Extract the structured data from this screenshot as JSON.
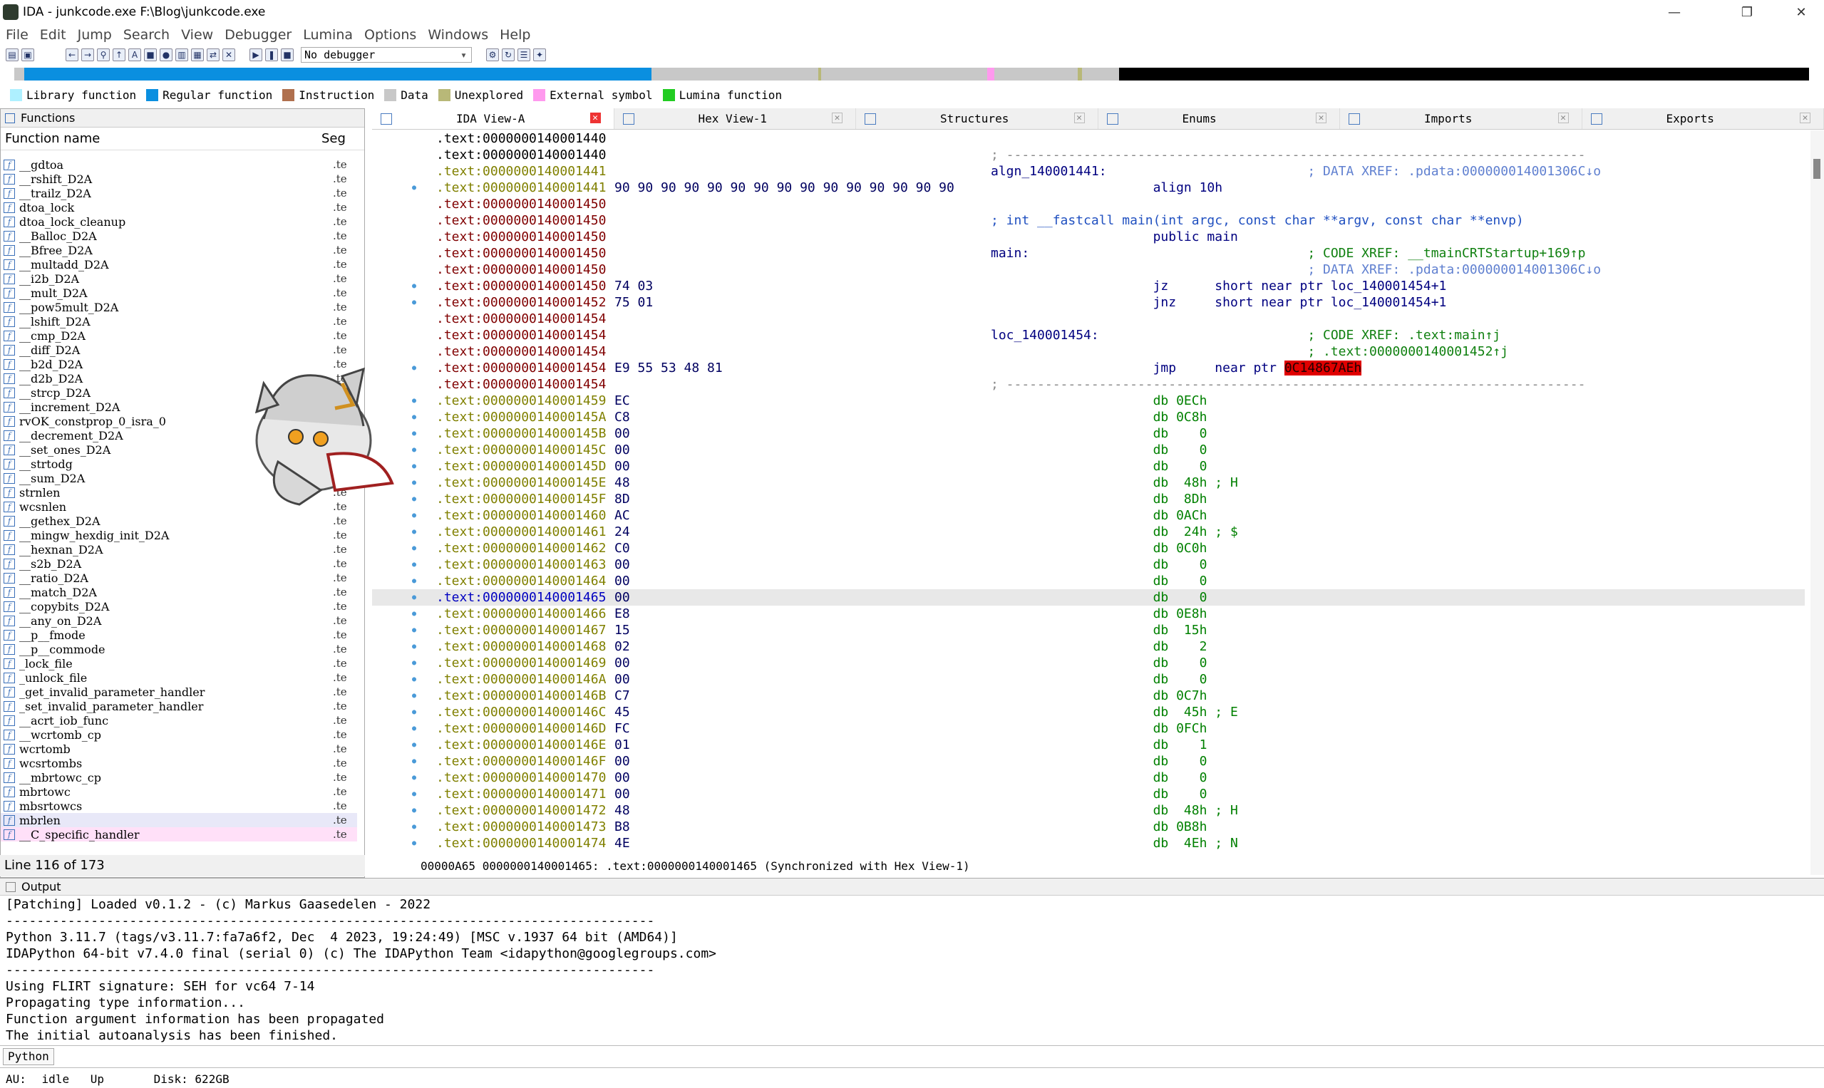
{
  "window": {
    "title": "IDA - junkcode.exe F:\\Blog\\junkcode.exe",
    "min_icon": "minimize-icon",
    "max_icon": "maximize-icon",
    "close_icon": "close-icon"
  },
  "menu": [
    "File",
    "Edit",
    "Jump",
    "Search",
    "View",
    "Debugger",
    "Lumina",
    "Options",
    "Windows",
    "Help"
  ],
  "toolbar": {
    "debugger_select": "No debugger"
  },
  "legend": [
    {
      "label": "Library function",
      "color": "#aef0ff"
    },
    {
      "label": "Regular function",
      "color": "#0a8fe0"
    },
    {
      "label": "Instruction",
      "color": "#b0704e"
    },
    {
      "label": "Data",
      "color": "#c8c8c8"
    },
    {
      "label": "Unexplored",
      "color": "#b8b878"
    },
    {
      "label": "External symbol",
      "color": "#ff99ee"
    },
    {
      "label": "Lumina function",
      "color": "#22cc22"
    }
  ],
  "functions": {
    "title": "Functions",
    "col_name": "Function name",
    "col_seg": "Seg",
    "items": [
      "__gdtoa",
      "__rshift_D2A",
      "__trailz_D2A",
      "dtoa_lock",
      "dtoa_lock_cleanup",
      "__Balloc_D2A",
      "__Bfree_D2A",
      "__multadd_D2A",
      "__i2b_D2A",
      "__mult_D2A",
      "__pow5mult_D2A",
      "__lshift_D2A",
      "__cmp_D2A",
      "__diff_D2A",
      "__b2d_D2A",
      "__d2b_D2A",
      "__strcp_D2A",
      "__increment_D2A",
      "rvOK_constprop_0_isra_0",
      "__decrement_D2A",
      "__set_ones_D2A",
      "__strtodg",
      "__sum_D2A",
      "strnlen",
      "wcsnlen",
      "__gethex_D2A",
      "__mingw_hexdig_init_D2A",
      "__hexnan_D2A",
      "__s2b_D2A",
      "__ratio_D2A",
      "__match_D2A",
      "__copybits_D2A",
      "__any_on_D2A",
      "__p__fmode",
      "__p__commode",
      "_lock_file",
      "_unlock_file",
      "_get_invalid_parameter_handler",
      "_set_invalid_parameter_handler",
      "__acrt_iob_func",
      "__wcrtomb_cp",
      "wcrtomb",
      "wcsrtombs",
      "__mbrtowc_cp",
      "mbrtowc",
      "mbsrtowcs",
      "mbrlen",
      "__C_specific_handler"
    ],
    "seg": ".te",
    "status": "Line 116 of 173"
  },
  "tabs": [
    {
      "label": "IDA View-A",
      "icon": "ida-view-icon"
    },
    {
      "label": "Hex View-1",
      "icon": "hex-view-icon"
    },
    {
      "label": "Structures",
      "icon": "structures-icon"
    },
    {
      "label": "Enums",
      "icon": "enums-icon"
    },
    {
      "label": "Imports",
      "icon": "imports-icon"
    },
    {
      "label": "Exports",
      "icon": "exports-icon"
    }
  ],
  "disasm": [
    {
      "addr": ".text:0000000140001440",
      "ac": "k",
      "bytes": "",
      "r": []
    },
    {
      "addr": ".text:0000000140001440",
      "ac": "k",
      "bytes": "",
      "r": [
        {
          "t": "; ---------------------------------------------------------------------------",
          "c": "grey"
        }
      ]
    },
    {
      "addr": ".text:0000000140001441",
      "ac": "g",
      "bytes": "",
      "r": [
        {
          "t": "algn_140001441:",
          "c": "navy"
        },
        {
          "t": "                          ; DATA XREF: .pdata:000000014001306C↓o",
          "c": "lblue"
        }
      ]
    },
    {
      "addr": ".text:0000000140001441",
      "ac": "g",
      "dot": true,
      "bytes": "90 90 90 90 90 90 90 90 90 90 90 90 90 90 90",
      "r": [
        {
          "t": "                     align 10h",
          "c": "navy"
        }
      ]
    },
    {
      "addr": ".text:0000000140001450",
      "ac": "r",
      "bytes": "",
      "r": []
    },
    {
      "addr": ".text:0000000140001450",
      "ac": "r",
      "bytes": "",
      "r": [
        {
          "t": "; int __fastcall main(int argc, const char **argv, const char **envp)",
          "c": "blue"
        }
      ]
    },
    {
      "addr": ".text:0000000140001450",
      "ac": "r",
      "bytes": "",
      "r": [
        {
          "t": "                     public main",
          "c": "navy"
        }
      ]
    },
    {
      "addr": ".text:0000000140001450",
      "ac": "r",
      "bytes": "",
      "r": [
        {
          "t": "main:",
          "c": "navy"
        },
        {
          "t": "                                    ; CODE XREF: __tmainCRTStartup+169↑p",
          "c": "green"
        }
      ]
    },
    {
      "addr": ".text:0000000140001450",
      "ac": "r",
      "bytes": "",
      "r": [
        {
          "t": "                                         ; DATA XREF: .pdata:000000014001306C↓o",
          "c": "lblue"
        }
      ]
    },
    {
      "addr": ".text:0000000140001450",
      "ac": "r",
      "dot": true,
      "bytes": "74 03",
      "r": [
        {
          "t": "                     jz      short near ptr loc_140001454+1",
          "c": "navy"
        }
      ]
    },
    {
      "addr": ".text:0000000140001452",
      "ac": "r",
      "dot": true,
      "bytes": "75 01",
      "r": [
        {
          "t": "                     jnz     short near ptr loc_140001454+1",
          "c": "navy"
        }
      ]
    },
    {
      "addr": ".text:0000000140001454",
      "ac": "r",
      "bytes": "",
      "r": []
    },
    {
      "addr": ".text:0000000140001454",
      "ac": "r",
      "bytes": "",
      "r": [
        {
          "t": "loc_140001454:",
          "c": "navy"
        },
        {
          "t": "                           ; CODE XREF: .text:main↑j",
          "c": "green"
        }
      ]
    },
    {
      "addr": ".text:0000000140001454",
      "ac": "r",
      "bytes": "",
      "r": [
        {
          "t": "                                         ; .text:0000000140001452↑j",
          "c": "green"
        }
      ]
    },
    {
      "addr": ".text:0000000140001454",
      "ac": "r",
      "dot": true,
      "bytes": "E9 55 53 48 81",
      "r": [
        {
          "t": "                     jmp     near ptr ",
          "c": "navy"
        },
        {
          "t": "0C14867AEh",
          "c": "redbox"
        }
      ]
    },
    {
      "addr": ".text:0000000140001454",
      "ac": "r",
      "bytes": "",
      "r": [
        {
          "t": "; ---------------------------------------------------------------------------",
          "c": "grey"
        }
      ]
    },
    {
      "addr": ".text:0000000140001459",
      "ac": "g",
      "dot": true,
      "bytes": "EC",
      "r": [
        {
          "t": "                     db 0ECh",
          "c": "g2"
        }
      ]
    },
    {
      "addr": ".text:000000014000145A",
      "ac": "g",
      "dot": true,
      "bytes": "C8",
      "r": [
        {
          "t": "                     db 0C8h",
          "c": "g2"
        }
      ]
    },
    {
      "addr": ".text:000000014000145B",
      "ac": "g",
      "dot": true,
      "bytes": "00",
      "r": [
        {
          "t": "                     db    0",
          "c": "g2"
        }
      ]
    },
    {
      "addr": ".text:000000014000145C",
      "ac": "g",
      "dot": true,
      "bytes": "00",
      "r": [
        {
          "t": "                     db    0",
          "c": "g2"
        }
      ]
    },
    {
      "addr": ".text:000000014000145D",
      "ac": "g",
      "dot": true,
      "bytes": "00",
      "r": [
        {
          "t": "                     db    0",
          "c": "g2"
        }
      ]
    },
    {
      "addr": ".text:000000014000145E",
      "ac": "g",
      "dot": true,
      "bytes": "48",
      "r": [
        {
          "t": "                     db  48h ; H",
          "c": "g2"
        }
      ]
    },
    {
      "addr": ".text:000000014000145F",
      "ac": "g",
      "dot": true,
      "bytes": "8D",
      "r": [
        {
          "t": "                     db  8Dh",
          "c": "g2"
        }
      ]
    },
    {
      "addr": ".text:0000000140001460",
      "ac": "g",
      "dot": true,
      "bytes": "AC",
      "r": [
        {
          "t": "                     db 0ACh",
          "c": "g2"
        }
      ]
    },
    {
      "addr": ".text:0000000140001461",
      "ac": "g",
      "dot": true,
      "bytes": "24",
      "r": [
        {
          "t": "                     db  24h ; $",
          "c": "g2"
        }
      ]
    },
    {
      "addr": ".text:0000000140001462",
      "ac": "g",
      "dot": true,
      "bytes": "C0",
      "r": [
        {
          "t": "                     db 0C0h",
          "c": "g2"
        }
      ]
    },
    {
      "addr": ".text:0000000140001463",
      "ac": "g",
      "dot": true,
      "bytes": "00",
      "r": [
        {
          "t": "                     db    0",
          "c": "g2"
        }
      ]
    },
    {
      "addr": ".text:0000000140001464",
      "ac": "g",
      "dot": true,
      "bytes": "00",
      "r": [
        {
          "t": "                     db    0",
          "c": "g2"
        }
      ]
    },
    {
      "addr": ".text:0000000140001465",
      "ac": "b",
      "dot": true,
      "hl": true,
      "bytes": "00",
      "r": [
        {
          "t": "                     db    0",
          "c": "g2"
        }
      ]
    },
    {
      "addr": ".text:0000000140001466",
      "ac": "g",
      "dot": true,
      "bytes": "E8",
      "r": [
        {
          "t": "                     db 0E8h",
          "c": "g2"
        }
      ]
    },
    {
      "addr": ".text:0000000140001467",
      "ac": "g",
      "dot": true,
      "bytes": "15",
      "r": [
        {
          "t": "                     db  15h",
          "c": "g2"
        }
      ]
    },
    {
      "addr": ".text:0000000140001468",
      "ac": "g",
      "dot": true,
      "bytes": "02",
      "r": [
        {
          "t": "                     db    2",
          "c": "g2"
        }
      ]
    },
    {
      "addr": ".text:0000000140001469",
      "ac": "g",
      "dot": true,
      "bytes": "00",
      "r": [
        {
          "t": "                     db    0",
          "c": "g2"
        }
      ]
    },
    {
      "addr": ".text:000000014000146A",
      "ac": "g",
      "dot": true,
      "bytes": "00",
      "r": [
        {
          "t": "                     db    0",
          "c": "g2"
        }
      ]
    },
    {
      "addr": ".text:000000014000146B",
      "ac": "g",
      "dot": true,
      "bytes": "C7",
      "r": [
        {
          "t": "                     db 0C7h",
          "c": "g2"
        }
      ]
    },
    {
      "addr": ".text:000000014000146C",
      "ac": "g",
      "dot": true,
      "bytes": "45",
      "r": [
        {
          "t": "                     db  45h ; E",
          "c": "g2"
        }
      ]
    },
    {
      "addr": ".text:000000014000146D",
      "ac": "g",
      "dot": true,
      "bytes": "FC",
      "r": [
        {
          "t": "                     db 0FCh",
          "c": "g2"
        }
      ]
    },
    {
      "addr": ".text:000000014000146E",
      "ac": "g",
      "dot": true,
      "bytes": "01",
      "r": [
        {
          "t": "                     db    1",
          "c": "g2"
        }
      ]
    },
    {
      "addr": ".text:000000014000146F",
      "ac": "g",
      "dot": true,
      "bytes": "00",
      "r": [
        {
          "t": "                     db    0",
          "c": "g2"
        }
      ]
    },
    {
      "addr": ".text:0000000140001470",
      "ac": "g",
      "dot": true,
      "bytes": "00",
      "r": [
        {
          "t": "                     db    0",
          "c": "g2"
        }
      ]
    },
    {
      "addr": ".text:0000000140001471",
      "ac": "g",
      "dot": true,
      "bytes": "00",
      "r": [
        {
          "t": "                     db    0",
          "c": "g2"
        }
      ]
    },
    {
      "addr": ".text:0000000140001472",
      "ac": "g",
      "dot": true,
      "bytes": "48",
      "r": [
        {
          "t": "                     db  48h ; H",
          "c": "g2"
        }
      ]
    },
    {
      "addr": ".text:0000000140001473",
      "ac": "g",
      "dot": true,
      "bytes": "B8",
      "r": [
        {
          "t": "                     db 0B8h",
          "c": "g2"
        }
      ]
    },
    {
      "addr": ".text:0000000140001474",
      "ac": "g",
      "dot": true,
      "bytes": "4E",
      "r": [
        {
          "t": "                     db  4Eh ; N",
          "c": "g2"
        }
      ]
    }
  ],
  "ida_status": "00000A65 0000000140001465: .text:0000000140001465 (Synchronized with Hex View-1)",
  "output": {
    "title": "Output",
    "lines": [
      "[Patching] Loaded v0.1.2 - (c) Markus Gaasedelen - 2022",
      "------------------------------------------------------------------------------------",
      "Python 3.11.7 (tags/v3.11.7:fa7a6f2, Dec  4 2023, 19:24:49) [MSC v.1937 64 bit (AMD64)]",
      "IDAPython 64-bit v7.4.0 final (serial 0) (c) The IDAPython Team <idapython@googlegroups.com>",
      "------------------------------------------------------------------------------------",
      "Using FLIRT signature: SEH for vc64 7-14",
      "Propagating type information...",
      "Function argument information has been propagated",
      "The initial autoanalysis has been finished."
    ]
  },
  "python_button": "Python",
  "status": {
    "au_label": "AU:",
    "au_value": "idle",
    "dir": "Up",
    "disk": "Disk: 622GB"
  },
  "colors": {
    "addr_black": "#000000",
    "addr_green": "#808000",
    "addr_red": "#800000",
    "addr_blue": "#0000c0",
    "db_green": "#008000"
  }
}
